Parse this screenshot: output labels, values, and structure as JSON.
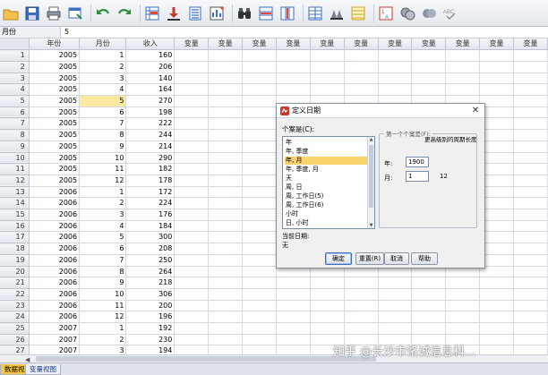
{
  "toolbar": {
    "icons": [
      "open-icon",
      "save-icon",
      "print-icon",
      "dialog-recall-icon",
      "undo-icon",
      "redo-icon",
      "goto-case-icon",
      "goto-variable-icon",
      "variables-icon",
      "run-descriptives-icon",
      "find-icon",
      "insert-cases-icon",
      "insert-variable-icon",
      "split-file-icon",
      "weight-cases-icon",
      "select-cases-icon",
      "value-labels-icon",
      "use-sets-icon",
      "show-all-icon",
      "spell-check-icon"
    ]
  },
  "editbar": {
    "cell_name": "月份",
    "cell_value": "5"
  },
  "grid": {
    "columns": [
      "年份",
      "月份",
      "收入",
      "变量",
      "变量",
      "变量",
      "变量",
      "变量",
      "变量",
      "变量",
      "变量",
      "变量",
      "变量",
      "变量"
    ],
    "rows": [
      {
        "n": "1",
        "year": "2005",
        "month": "1",
        "income": "160"
      },
      {
        "n": "2",
        "year": "2005",
        "month": "2",
        "income": "206"
      },
      {
        "n": "3",
        "year": "2005",
        "month": "3",
        "income": "140"
      },
      {
        "n": "4",
        "year": "2005",
        "month": "4",
        "income": "164"
      },
      {
        "n": "5",
        "year": "2005",
        "month": "5",
        "income": "270"
      },
      {
        "n": "6",
        "year": "2005",
        "month": "6",
        "income": "198"
      },
      {
        "n": "7",
        "year": "2005",
        "month": "7",
        "income": "222"
      },
      {
        "n": "8",
        "year": "2005",
        "month": "8",
        "income": "244"
      },
      {
        "n": "9",
        "year": "2005",
        "month": "9",
        "income": "214"
      },
      {
        "n": "10",
        "year": "2005",
        "month": "10",
        "income": "290"
      },
      {
        "n": "11",
        "year": "2005",
        "month": "11",
        "income": "182"
      },
      {
        "n": "12",
        "year": "2005",
        "month": "12",
        "income": "178"
      },
      {
        "n": "13",
        "year": "2006",
        "month": "1",
        "income": "172"
      },
      {
        "n": "14",
        "year": "2006",
        "month": "2",
        "income": "224"
      },
      {
        "n": "15",
        "year": "2006",
        "month": "3",
        "income": "176"
      },
      {
        "n": "16",
        "year": "2006",
        "month": "4",
        "income": "184"
      },
      {
        "n": "17",
        "year": "2006",
        "month": "5",
        "income": "300"
      },
      {
        "n": "18",
        "year": "2006",
        "month": "6",
        "income": "208"
      },
      {
        "n": "19",
        "year": "2006",
        "month": "7",
        "income": "250"
      },
      {
        "n": "20",
        "year": "2006",
        "month": "8",
        "income": "264"
      },
      {
        "n": "21",
        "year": "2006",
        "month": "9",
        "income": "218"
      },
      {
        "n": "22",
        "year": "2006",
        "month": "10",
        "income": "306"
      },
      {
        "n": "23",
        "year": "2006",
        "month": "11",
        "income": "200"
      },
      {
        "n": "24",
        "year": "2006",
        "month": "12",
        "income": "196"
      },
      {
        "n": "25",
        "year": "2007",
        "month": "1",
        "income": "192"
      },
      {
        "n": "26",
        "year": "2007",
        "month": "2",
        "income": "230"
      },
      {
        "n": "27",
        "year": "2007",
        "month": "3",
        "income": "194"
      },
      {
        "n": "28",
        "year": "2007",
        "month": "4",
        "income": "196"
      }
    ],
    "selected_row": "5"
  },
  "tabs": {
    "data_view": "数据视图",
    "variable_view": "变量视图"
  },
  "dialog": {
    "title": "定义日期",
    "close_glyph": "✕",
    "cases_label": "个案是(C):",
    "list_items": [
      "年",
      "年, 季度",
      "年, 月",
      "年, 季度, 月",
      "天",
      "周, 日",
      "周, 工作日(5)",
      "周, 工作日(6)",
      "小时",
      "日, 小时"
    ],
    "selected_item": "年, 月",
    "current_date_label": "当前日期:",
    "current_date_value": "无",
    "group_legend": "第一个个案是(F):",
    "group_hint": "更高级别的周期长度",
    "year_label": "年:",
    "year_value": "1900",
    "month_label": "月:",
    "month_value": "1",
    "month_period": "12",
    "buttons": {
      "ok": "确定",
      "reset": "重置(R)",
      "cancel": "取消",
      "help": "帮助"
    }
  },
  "watermark": "知乎 @长沙市恪诚信息科..."
}
